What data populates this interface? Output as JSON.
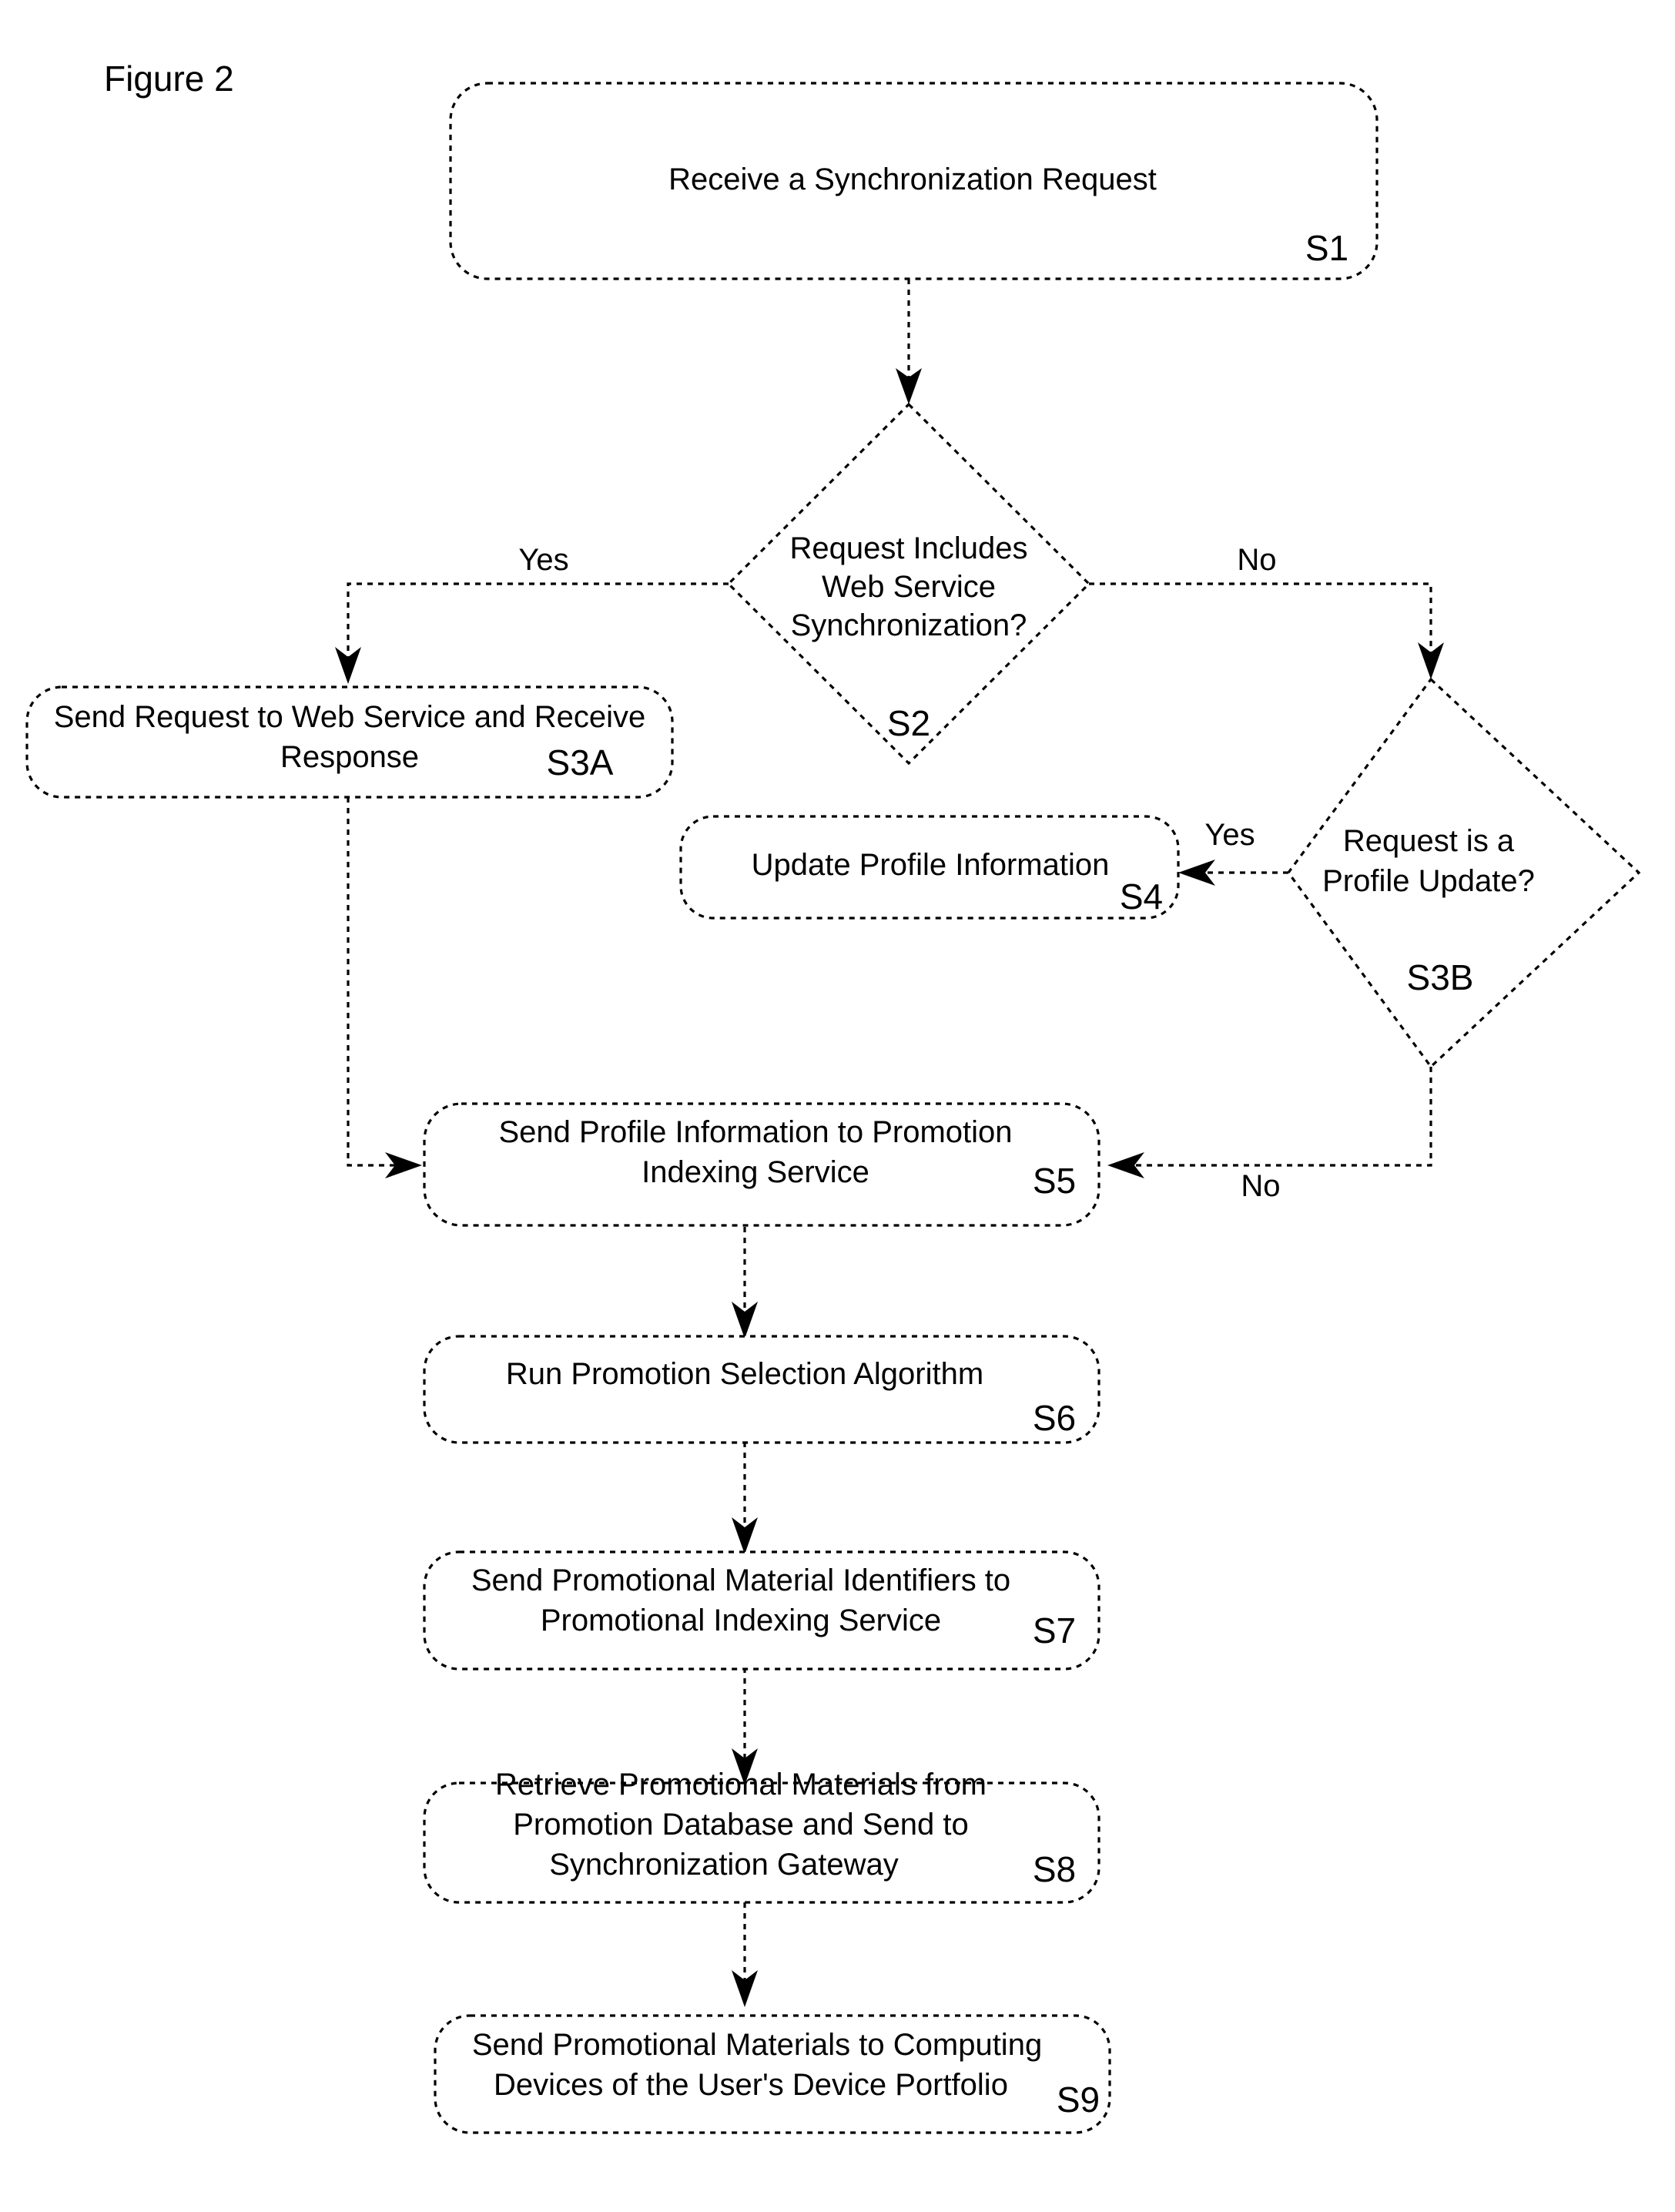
{
  "figure": {
    "title": "Figure 2",
    "type": "flowchart"
  },
  "nodes": {
    "s1": {
      "id": "S1",
      "shape": "rounded-rectangle",
      "lines": [
        "Receive a Synchronization Request"
      ]
    },
    "s2": {
      "id": "S2",
      "shape": "diamond",
      "lines": [
        "Request Includes",
        "Web Service",
        "Synchronization?"
      ]
    },
    "s3a": {
      "id": "S3A",
      "shape": "rounded-rectangle",
      "lines": [
        "Send Request to Web Service and Receive",
        "Response"
      ]
    },
    "s3b": {
      "id": "S3B",
      "shape": "diamond",
      "lines": [
        "Request is a",
        "Profile Update?"
      ]
    },
    "s4": {
      "id": "S4",
      "shape": "rounded-rectangle",
      "lines": [
        "Update Profile Information"
      ]
    },
    "s5": {
      "id": "S5",
      "shape": "rounded-rectangle",
      "lines": [
        "Send Profile Information to Promotion",
        "Indexing Service"
      ]
    },
    "s6": {
      "id": "S6",
      "shape": "rounded-rectangle",
      "lines": [
        "Run Promotion Selection Algorithm"
      ]
    },
    "s7": {
      "id": "S7",
      "shape": "rounded-rectangle",
      "lines": [
        "Send Promotional Material Identifiers to",
        "Promotional Indexing Service"
      ]
    },
    "s8": {
      "id": "S8",
      "shape": "rounded-rectangle",
      "lines": [
        "Retrieve Promotional Materials from",
        "Promotion Database and Send to",
        "Synchronization Gateway"
      ]
    },
    "s9": {
      "id": "S9",
      "shape": "rounded-rectangle",
      "lines": [
        "Send Promotional Materials to Computing",
        "Devices of the User's Device Portfolio"
      ]
    }
  },
  "edge_labels": {
    "s2_yes": "Yes",
    "s2_no": "No",
    "s3b_yes": "Yes",
    "s3b_no": "No"
  },
  "colors": {
    "line": "#000000",
    "fill": "#ffffff",
    "text": "#000000"
  }
}
